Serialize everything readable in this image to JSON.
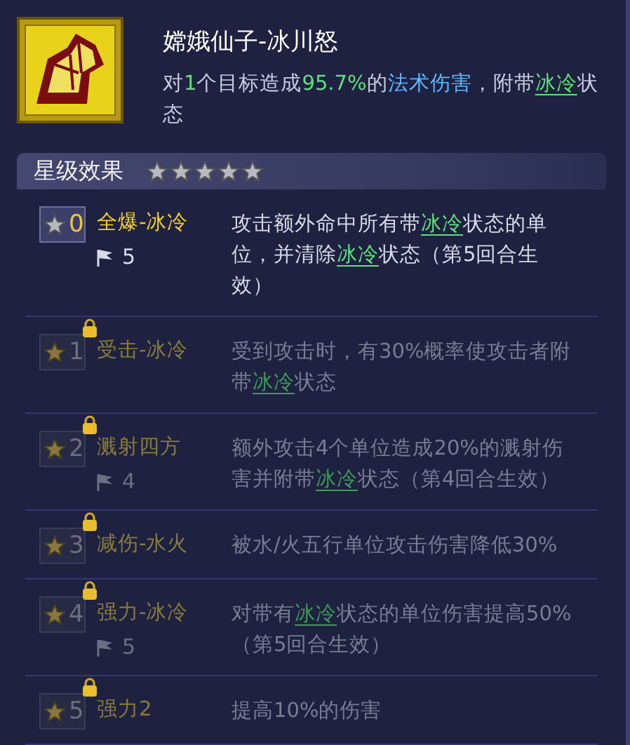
{
  "skill": {
    "title": "嫦娥仙子-冰川怒",
    "description": [
      {
        "kind": "plain",
        "text": "对"
      },
      {
        "kind": "number",
        "text": "1"
      },
      {
        "kind": "plain",
        "text": "个目标造成"
      },
      {
        "kind": "number",
        "text": "95.7%"
      },
      {
        "kind": "plain",
        "text": "的"
      },
      {
        "kind": "term",
        "text": "法术伤害"
      },
      {
        "kind": "plain",
        "text": "，附带"
      },
      {
        "kind": "status",
        "text": "冰冷"
      },
      {
        "kind": "plain",
        "text": "状态"
      }
    ]
  },
  "section": {
    "title": "星级效果",
    "stars": 5
  },
  "effects": [
    {
      "level": "0",
      "name": "全爆-冰冷",
      "flag": "5",
      "locked": false,
      "description": [
        {
          "kind": "plain",
          "text": "攻击额外命中所有带"
        },
        {
          "kind": "status",
          "text": "冰冷"
        },
        {
          "kind": "plain",
          "text": "状态的单位，并清除"
        },
        {
          "kind": "status",
          "text": "冰冷"
        },
        {
          "kind": "plain",
          "text": "状态（第5回合生效）"
        }
      ]
    },
    {
      "level": "1",
      "name": "受击-冰冷",
      "locked": true,
      "description": [
        {
          "kind": "plain",
          "text": "受到攻击时，有30%概率使攻击者附带"
        },
        {
          "kind": "status",
          "text": "冰冷"
        },
        {
          "kind": "plain",
          "text": "状态"
        }
      ]
    },
    {
      "level": "2",
      "name": "溅射四方",
      "flag": "4",
      "locked": true,
      "description": [
        {
          "kind": "plain",
          "text": "额外攻击4个单位造成20%的溅射伤害并附带"
        },
        {
          "kind": "status",
          "text": "冰冷"
        },
        {
          "kind": "plain",
          "text": "状态（第4回合生效）"
        }
      ]
    },
    {
      "level": "3",
      "name": "减伤-水火",
      "locked": true,
      "description": [
        {
          "kind": "plain",
          "text": "被水/火五行单位攻击伤害降低30%"
        }
      ]
    },
    {
      "level": "4",
      "name": "强力-冰冷",
      "flag": "5",
      "locked": true,
      "description": [
        {
          "kind": "plain",
          "text": "对带有"
        },
        {
          "kind": "status",
          "text": "冰冷"
        },
        {
          "kind": "plain",
          "text": "状态的单位伤害提高50%（第5回合生效）"
        }
      ]
    },
    {
      "level": "5",
      "name": "强力2",
      "locked": true,
      "description": [
        {
          "kind": "plain",
          "text": "提高10%的伤害"
        }
      ]
    }
  ]
}
